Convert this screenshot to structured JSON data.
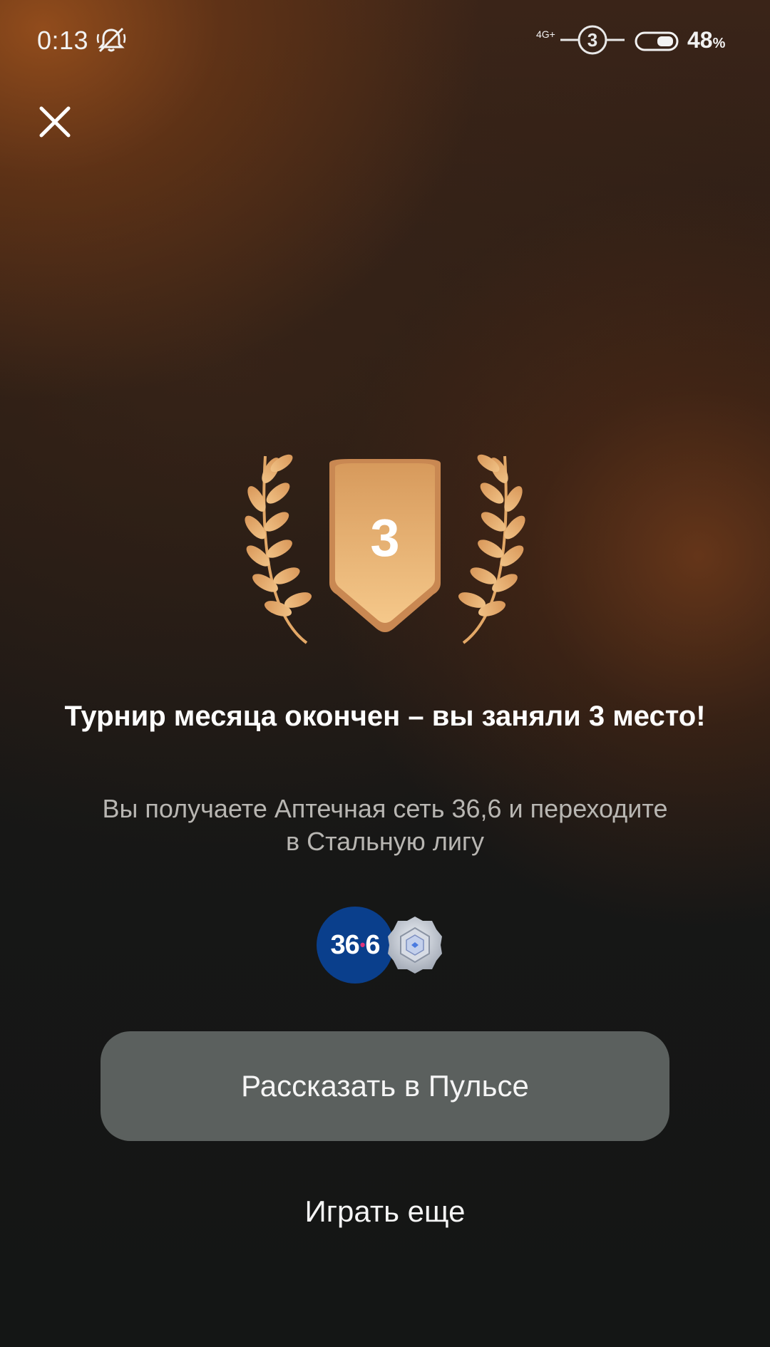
{
  "status_bar": {
    "time": "0:13",
    "network": "4G+",
    "sim_number": "3",
    "battery_value": "48",
    "battery_unit": "%"
  },
  "result": {
    "place": "3",
    "headline": "Турнир месяца окончен – вы заняли 3 место!",
    "subtext": "Вы получаете Аптечная сеть 36,6 и переходите в Стальную лигу"
  },
  "rewards": {
    "pharmacy_logo_main": "36",
    "pharmacy_logo_dot": "•",
    "pharmacy_logo_tail": "6",
    "league_icon": "steel-league-badge-icon"
  },
  "actions": {
    "share_label": "Рассказать в Пульсе",
    "play_again_label": "Играть еще"
  },
  "colors": {
    "accent_bronze": "#e3a062",
    "button_bg": "#5b605e",
    "pharmacy_blue": "#0a3f8c"
  }
}
